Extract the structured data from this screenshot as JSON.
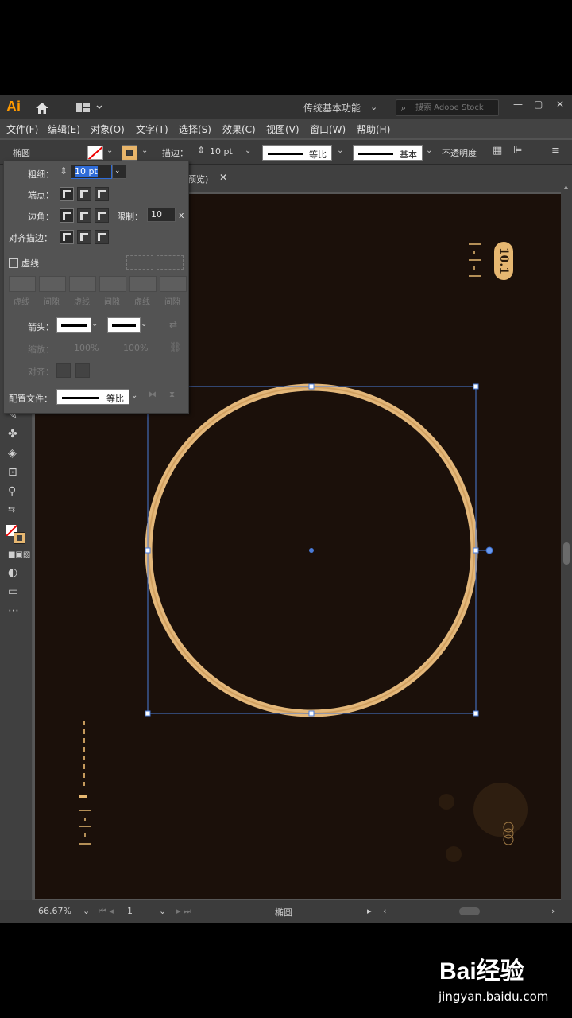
{
  "app": {
    "logo": "Ai",
    "workspace": "传统基本功能",
    "search_placeholder": "搜索 Adobe Stock"
  },
  "menu": [
    "文件(F)",
    "编辑(E)",
    "对象(O)",
    "文字(T)",
    "选择(S)",
    "效果(C)",
    "视图(V)",
    "窗口(W)",
    "帮助(H)"
  ],
  "control_bar": {
    "object_type": "椭圆",
    "stroke_label": "描边：",
    "stroke_weight": "10 pt",
    "profile": "等比",
    "brush": "基本",
    "opacity": "不透明度"
  },
  "document_tab": {
    "label_fragment": "预览)"
  },
  "stroke_panel": {
    "weight_label": "粗细：",
    "weight_value": "10 pt",
    "cap_label": "端点：",
    "corner_label": "边角：",
    "limit_label": "限制：",
    "limit_value": "10",
    "limit_unit": "x",
    "align_label": "对齐描边：",
    "dashed_label": "虚线",
    "dash_cells": [
      "虚线",
      "间隙",
      "虚线",
      "间隙",
      "虚线",
      "间隙"
    ],
    "arrowhead_label": "箭头：",
    "scale_label": "缩放：",
    "scale_start": "100%",
    "scale_end": "100%",
    "align2_label": "对齐：",
    "profile_label": "配置文件：",
    "profile_value": "等比"
  },
  "artboard": {
    "badge_text": "10.1",
    "background": "#1b100a",
    "accent": "#e6b771"
  },
  "status_bar": {
    "zoom": "66.67%",
    "artboard_num": "1",
    "tool_name": "椭圆"
  },
  "watermark": {
    "brand": "Bai经验",
    "url": "jingyan.baidu.com"
  }
}
